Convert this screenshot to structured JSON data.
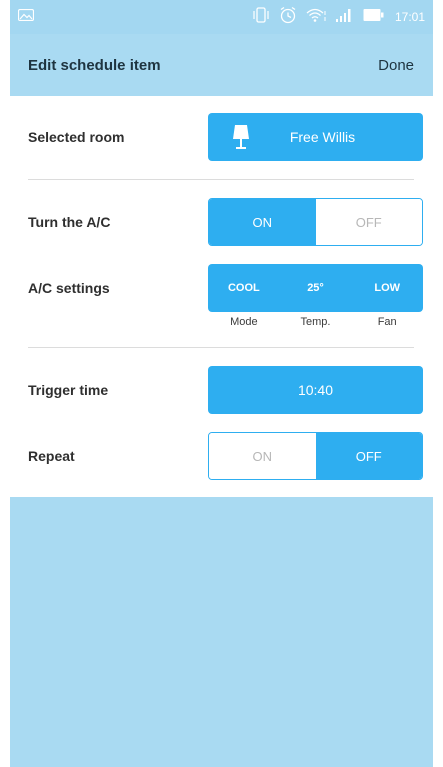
{
  "status_bar": {
    "time": "17:01",
    "icons": [
      "image-icon",
      "vibrate-icon",
      "alarm-icon",
      "wifi-icon",
      "signal-icon",
      "battery-icon"
    ]
  },
  "header": {
    "title": "Edit schedule item",
    "done_label": "Done"
  },
  "rows": {
    "room": {
      "label": "Selected room",
      "value": "Free Willis",
      "icon": "lamp-icon"
    },
    "ac_turn": {
      "label": "Turn the A/C",
      "on_label": "ON",
      "off_label": "OFF",
      "selected": "ON"
    },
    "ac_settings": {
      "label": "A/C settings",
      "mode": "COOL",
      "temp": "25°",
      "fan": "LOW",
      "mode_caption": "Mode",
      "temp_caption": "Temp.",
      "fan_caption": "Fan"
    },
    "trigger": {
      "label": "Trigger time",
      "value": "10:40"
    },
    "repeat": {
      "label": "Repeat",
      "on_label": "ON",
      "off_label": "OFF",
      "selected": "OFF"
    }
  },
  "colors": {
    "accent": "#2eaef0",
    "header_bg": "#a9daf2",
    "panel_bg": "#ffffff"
  }
}
